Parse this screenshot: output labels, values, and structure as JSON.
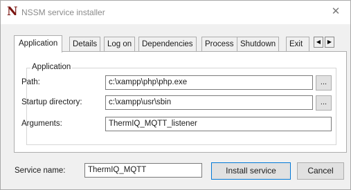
{
  "window": {
    "title": "NSSM service installer",
    "icon_glyph": "N",
    "close_glyph": "✕"
  },
  "tabs": [
    {
      "label": "Application",
      "active": true
    },
    {
      "label": "Details"
    },
    {
      "label": "Log on"
    },
    {
      "label": "Dependencies"
    },
    {
      "label": "Process"
    },
    {
      "label": "Shutdown"
    },
    {
      "label": "Exit"
    }
  ],
  "tab_scroll": {
    "left": "◀",
    "right": "▶"
  },
  "application": {
    "group_label": "Application",
    "path_label": "Path:",
    "path_value": "c:\\xampp\\php\\php.exe",
    "startup_label": "Startup directory:",
    "startup_value": "c:\\xampp\\usr\\sbin",
    "arguments_label": "Arguments:",
    "arguments_value": "ThermIQ_MQTT_listener",
    "browse_label": "..."
  },
  "footer": {
    "service_name_label": "Service name:",
    "service_name_value": "ThermIQ_MQTT",
    "install_label": "Install service",
    "cancel_label": "Cancel"
  },
  "colors": {
    "icon_red": "#7a1410",
    "window_bg": "#f0f0f0",
    "accent_blue": "#0078d7"
  }
}
